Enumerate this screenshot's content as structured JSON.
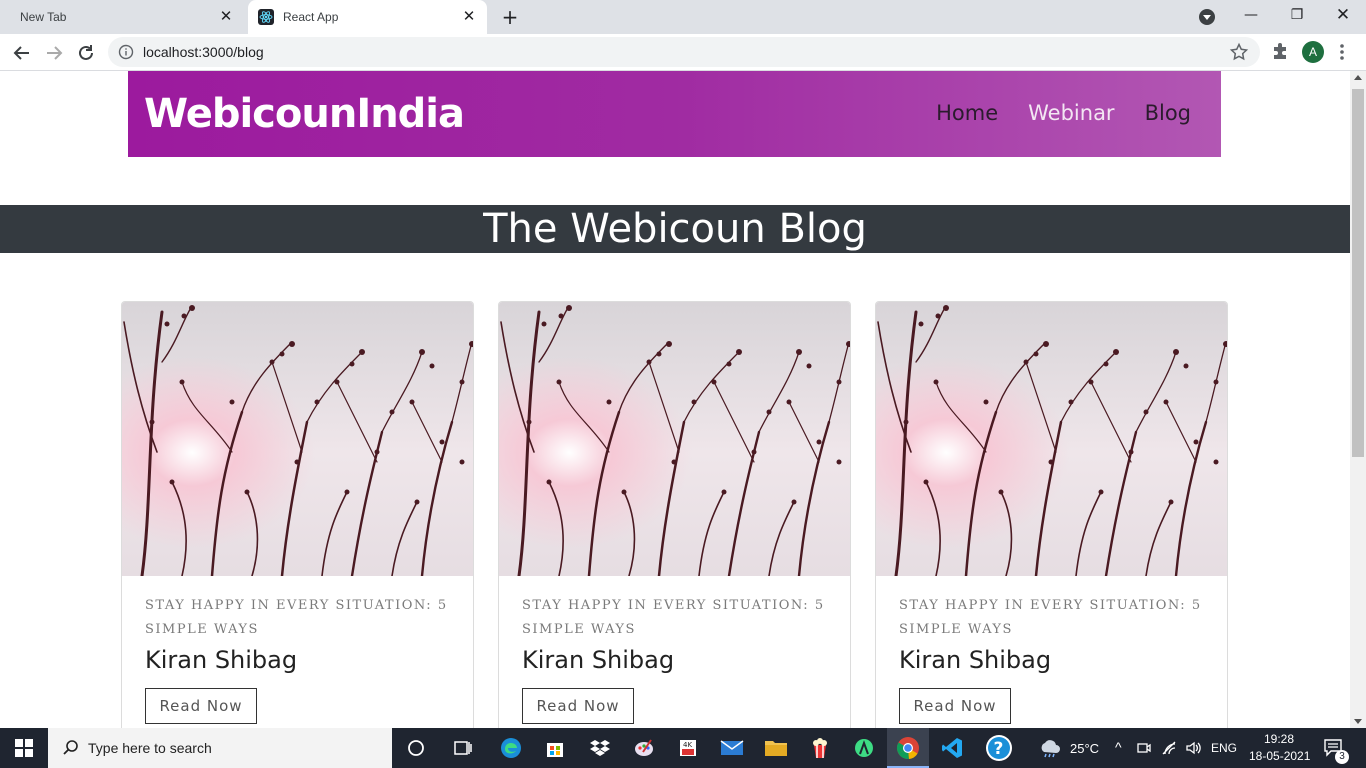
{
  "browser": {
    "tabs": [
      {
        "title": "New Tab",
        "active": false
      },
      {
        "title": "React App",
        "active": true
      }
    ],
    "url": "localhost:3000/blog",
    "profile_initial": "A"
  },
  "site": {
    "brand": "WebicounIndia",
    "nav": [
      {
        "label": "Home"
      },
      {
        "label": "Webinar"
      },
      {
        "label": "Blog"
      }
    ],
    "hero_title": "The Webicoun Blog"
  },
  "cards": [
    {
      "caption": "STAY HAPPY IN EVERY SITUATION: 5 SIMPLE WAYS",
      "author": "Kiran Shibag",
      "button": "Read Now"
    },
    {
      "caption": "STAY HAPPY IN EVERY SITUATION: 5 SIMPLE WAYS",
      "author": "Kiran Shibag",
      "button": "Read Now"
    },
    {
      "caption": "STAY HAPPY IN EVERY SITUATION: 5 SIMPLE WAYS",
      "author": "Kiran Shibag",
      "button": "Read Now"
    }
  ],
  "taskbar": {
    "search_placeholder": "Type here to search",
    "weather": "25°C",
    "language": "ENG",
    "time": "19:28",
    "date": "18-05-2021",
    "notifications": "3"
  },
  "colors": {
    "header_start": "#9c1a9e",
    "header_end": "#b257b3",
    "hero_bg": "#343a40"
  }
}
